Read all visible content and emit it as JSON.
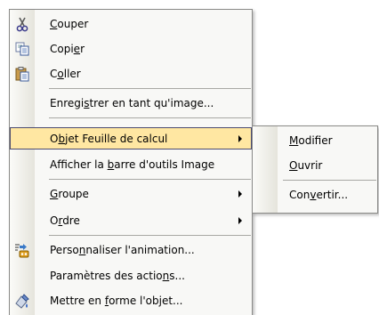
{
  "menu": {
    "items": [
      {
        "pre": "",
        "acc": "C",
        "post": "ouper",
        "icon": "scissors-icon"
      },
      {
        "pre": "Copi",
        "acc": "e",
        "post": "r",
        "icon": "copy-icon"
      },
      {
        "pre": "C",
        "acc": "o",
        "post": "ller",
        "icon": "paste-icon"
      },
      {
        "pre": "Enregi",
        "acc": "s",
        "post": "trer en tant qu'image...",
        "icon": ""
      },
      {
        "pre": "O",
        "acc": "b",
        "post": "jet Feuille de calcul",
        "icon": ""
      },
      {
        "pre": "Afficher la ",
        "acc": "b",
        "post": "arre d'outils Image",
        "icon": ""
      },
      {
        "pre": "",
        "acc": "G",
        "post": "roupe",
        "icon": ""
      },
      {
        "pre": "O",
        "acc": "r",
        "post": "dre",
        "icon": ""
      },
      {
        "pre": "Perso",
        "acc": "n",
        "post": "naliser l'animation...",
        "icon": "custom-animation-icon"
      },
      {
        "pre": "Paramètres des actio",
        "acc": "n",
        "post": "s...",
        "icon": ""
      },
      {
        "pre": "Mettre en ",
        "acc": "f",
        "post": "orme l'objet...",
        "icon": "format-object-icon"
      }
    ]
  },
  "submenu": {
    "items": [
      {
        "pre": "",
        "acc": "M",
        "post": "odifier"
      },
      {
        "pre": "",
        "acc": "O",
        "post": "uvrir"
      },
      {
        "pre": "Con",
        "acc": "v",
        "post": "ertir..."
      }
    ]
  },
  "colors": {
    "highlight": "#ffe7a2",
    "highlight_border": "#4b4b6f"
  }
}
